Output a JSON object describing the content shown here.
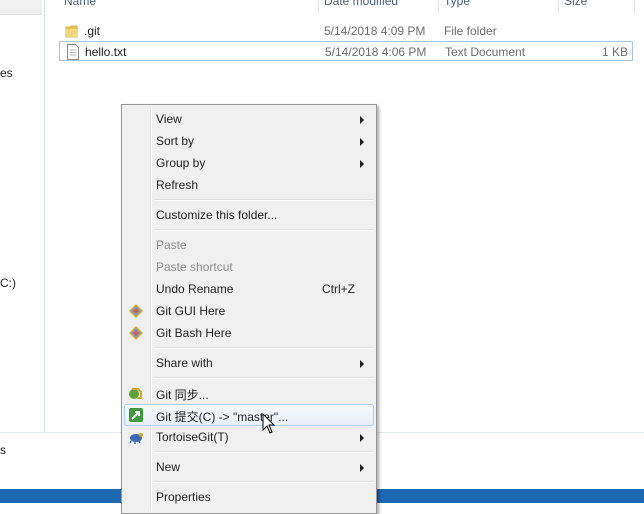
{
  "nav": {
    "items": [
      "es",
      "C:)",
      "s"
    ]
  },
  "columns": {
    "name": "Name",
    "date": "Date modified",
    "type": "Type",
    "size": "Size"
  },
  "files": [
    {
      "name": ".git",
      "date": "5/14/2018 4:09 PM",
      "type": "File folder",
      "size": "",
      "icon": "folder-icon"
    },
    {
      "name": "hello.txt",
      "date": "5/14/2018 4:06 PM",
      "type": "Text Document",
      "size": "1 KB",
      "icon": "text-document-icon"
    }
  ],
  "menu": {
    "view": "View",
    "sort_by": "Sort by",
    "group_by": "Group by",
    "refresh": "Refresh",
    "customize": "Customize this folder...",
    "paste": "Paste",
    "paste_shortcut": "Paste shortcut",
    "undo_rename": "Undo Rename",
    "undo_accel": "Ctrl+Z",
    "git_gui": "Git GUI Here",
    "git_bash": "Git Bash Here",
    "share_with": "Share with",
    "git_sync": "Git 同步...",
    "git_commit": "Git 提交(C) -> \"master\"...",
    "tortoisegit": "TortoiseGit(T)",
    "new": "New",
    "properties": "Properties"
  },
  "colors": {
    "menu_bg": "#f0f0f0",
    "hover_border": "#aecff7",
    "taskbar": "#1c69b2"
  }
}
